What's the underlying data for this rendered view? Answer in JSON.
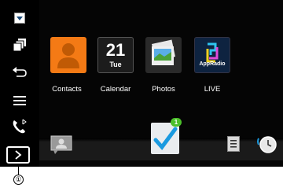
{
  "apps": [
    {
      "label": "Contacts",
      "icon": "contacts-icon",
      "color": "#f47a15"
    },
    {
      "label": "Calendar",
      "icon": "calendar-icon",
      "day_number": "21",
      "day_name": "Tue"
    },
    {
      "label": "Photos",
      "icon": "photos-icon"
    },
    {
      "label": "LIVE",
      "icon": "appradio-live-icon",
      "tile_text": "AppRadio"
    }
  ],
  "sidebar": {
    "items": [
      {
        "icon": "dropdown-arrow-icon"
      },
      {
        "icon": "multitask-windows-icon"
      },
      {
        "icon": "back-arrow-icon"
      },
      {
        "icon": "menu-icon"
      },
      {
        "icon": "phone-bluetooth-icon"
      },
      {
        "icon": "chevron-right-icon"
      }
    ]
  },
  "bottom_bar": {
    "left_icon": "contact-card-icon",
    "center_icon": "checkmark-tasks-icon",
    "notification_badge": "1",
    "right_icons": [
      "list-icon",
      "clock-icon"
    ]
  },
  "callout": {
    "number": "①"
  },
  "colors": {
    "accent": "#1a9ae0",
    "background": "#050505",
    "badge": "#4bbf2a"
  }
}
